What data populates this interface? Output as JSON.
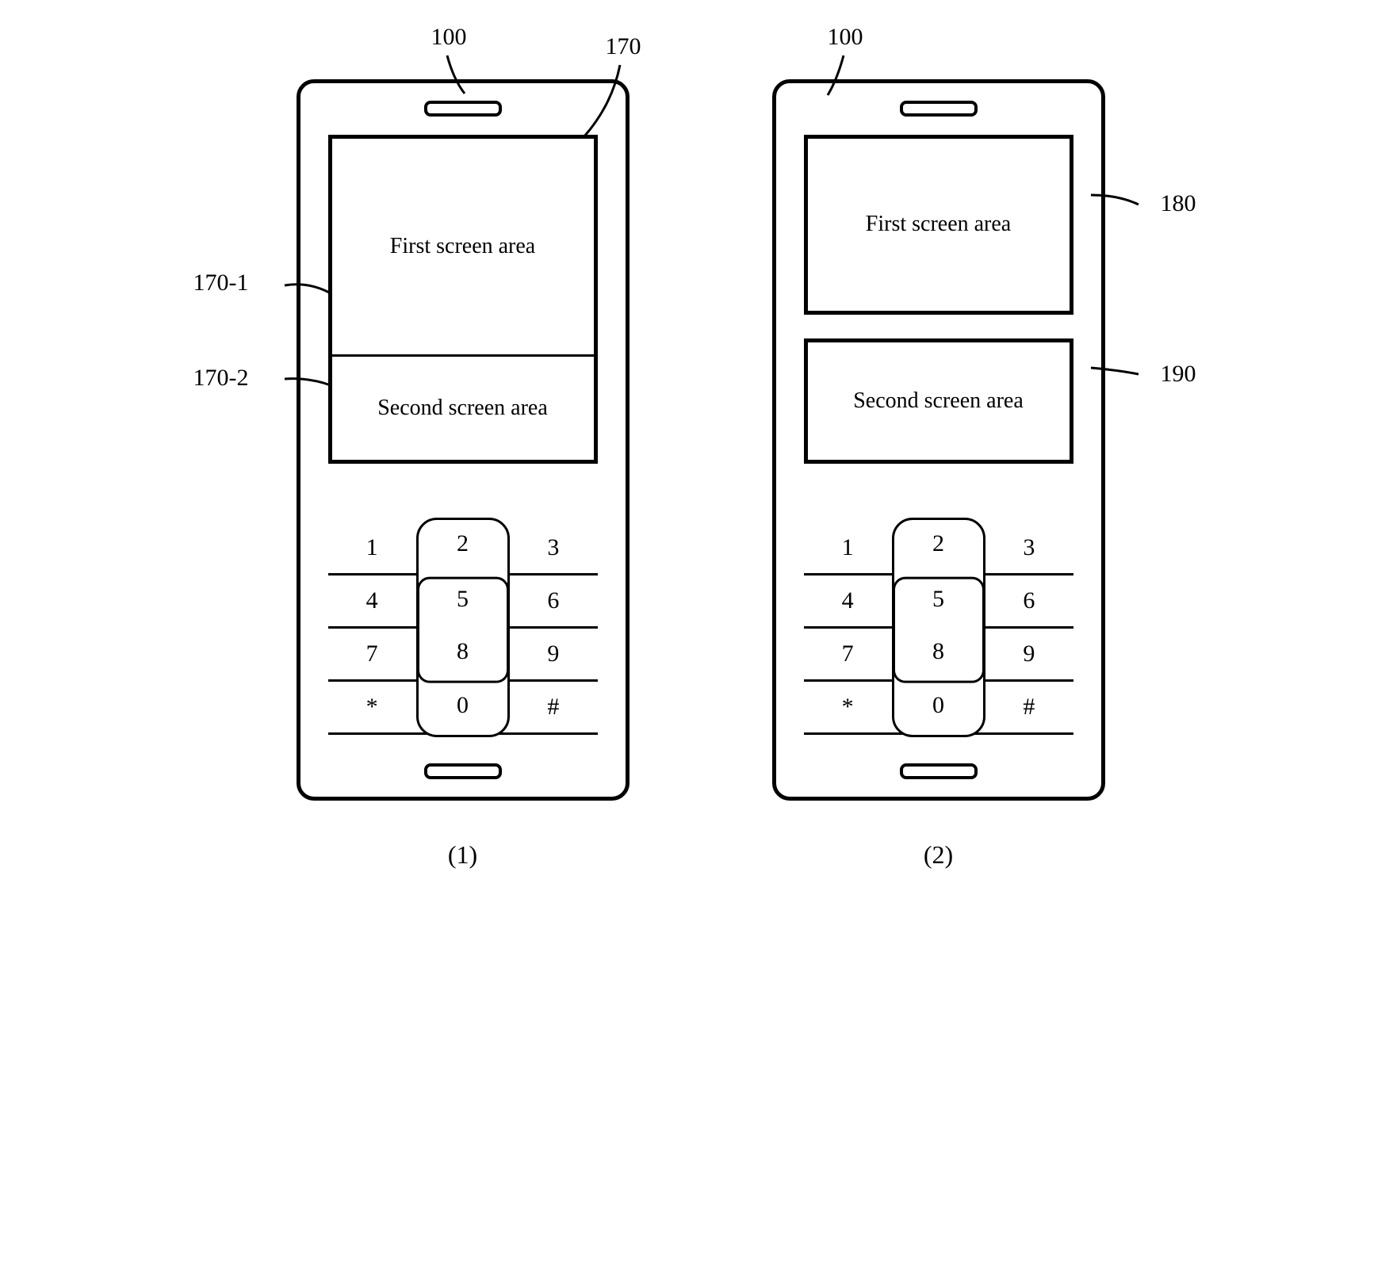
{
  "left": {
    "ref_device": "100",
    "ref_screen": "170",
    "ref_area_top": "170-1",
    "ref_area_bot": "170-2",
    "area_top_label": "First screen area",
    "area_bot_label": "Second screen area",
    "caption": "(1)"
  },
  "right": {
    "ref_device": "100",
    "ref_area_top": "180",
    "ref_area_bot": "190",
    "area_top_label": "First screen area",
    "area_bot_label": "Second screen area",
    "caption": "(2)"
  },
  "keypad": {
    "rows": [
      [
        "1",
        "2",
        "3"
      ],
      [
        "4",
        "5",
        "6"
      ],
      [
        "7",
        "8",
        "9"
      ],
      [
        "*",
        "0",
        "#"
      ]
    ]
  }
}
